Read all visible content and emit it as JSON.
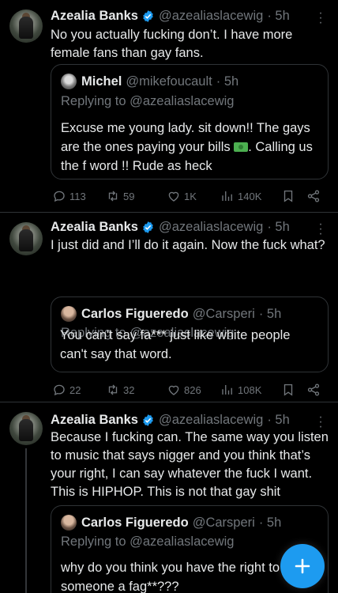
{
  "tweets": [
    {
      "name": "Azealia Banks",
      "handle": "@azealiaslacewig",
      "time": "· 5h",
      "text": "No you actually fucking don’t. I have more female fans than gay fans.",
      "quote": {
        "name": "Michel",
        "handle": "@mikefoucault",
        "time": "· 5h",
        "replying": "Replying to @azealiaslacewig",
        "text_before_emoji": "Excuse me young lady. sit down!! The gays are the ones paying your bills ",
        "emoji": "money-emoji",
        "text_after_emoji": ". Calling us the f word !! Rude as heck"
      },
      "stats": {
        "replies": "113",
        "reposts": "59",
        "likes": "1K",
        "views": "140K"
      }
    },
    {
      "name": "Azealia Banks",
      "handle": "@azealiaslacewig",
      "time": "· 5h",
      "text": "I just did and I’ll do it again. Now the fuck what?",
      "quote": {
        "name": "Carlos Figueredo",
        "handle": "@Carsperi",
        "time": "· 5h",
        "replying": "Replying to @azealiaslacewig",
        "text": "You can't say fa*** just like white people can't say that word."
      },
      "stats": {
        "replies": "22",
        "reposts": "32",
        "likes": "826",
        "views": "108K"
      }
    },
    {
      "name": "Azealia Banks",
      "handle": "@azealiaslacewig",
      "time": "· 5h",
      "text": "Because I fucking can. The same way you listen to music that says nigger and you think that’s your right, I can say whatever the fuck I want. This is HIPHOP. This is not that gay shit",
      "quote": {
        "name": "Carlos Figueredo",
        "handle": "@Carsperi",
        "time": "· 5h",
        "replying": "Replying to @azealiaslacewig",
        "text": "why do you think you have the right to call someone a fag**???"
      }
    }
  ],
  "icons": {
    "more": "more-dots-icon",
    "verified": "verified-badge-icon",
    "reply": "reply-icon",
    "repost": "repost-icon",
    "like": "like-icon",
    "views": "views-icon",
    "bookmark": "bookmark-icon",
    "share": "share-icon",
    "compose": "compose-plus-icon"
  },
  "colors": {
    "accent": "#1d9bf0",
    "background": "#000000",
    "muted": "#71767b",
    "text": "#e7e9ea"
  }
}
